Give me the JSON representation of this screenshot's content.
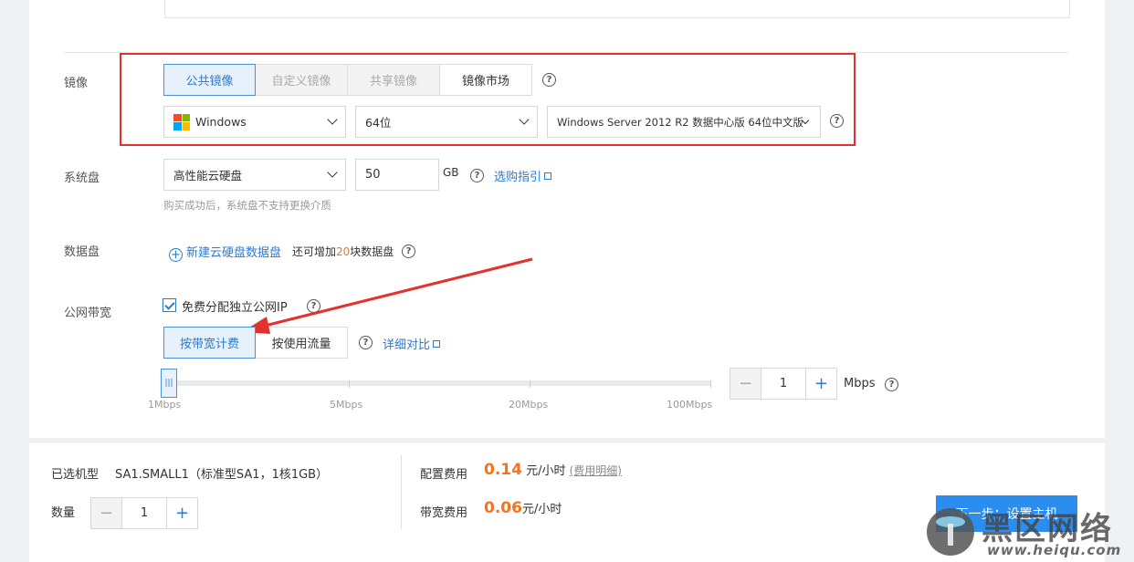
{
  "image_section": {
    "label": "镜像",
    "tabs": [
      {
        "label": "公共镜像",
        "state": "active"
      },
      {
        "label": "自定义镜像",
        "state": "disabled"
      },
      {
        "label": "共享镜像",
        "state": "disabled"
      },
      {
        "label": "镜像市场",
        "state": "normal"
      }
    ],
    "help": "?",
    "os_select": "Windows",
    "bits_select": "64位",
    "version_select": "Windows Server 2012 R2 数据中心版 64位中文版"
  },
  "system_disk": {
    "label": "系统盘",
    "type_select": "高性能云硬盘",
    "size_value": "50",
    "unit": "GB",
    "guide_link": "选购指引",
    "hint": "购买成功后，系统盘不支持更换介质"
  },
  "data_disk": {
    "label": "数据盘",
    "add_link": "新建云硬盘数据盘",
    "remaining_prefix": "还可增加",
    "remaining_count": "20",
    "remaining_suffix": "块数据盘"
  },
  "bandwidth": {
    "label": "公网带宽",
    "free_ip_checkbox": "免费分配独立公网IP",
    "free_ip_checked": true,
    "billing_tabs": [
      {
        "label": "按带宽计费",
        "state": "active"
      },
      {
        "label": "按使用流量",
        "state": "normal"
      }
    ],
    "compare_link": "详细对比",
    "slider_handle": "|||",
    "slider_ticks": [
      "1Mbps",
      "5Mbps",
      "20Mbps",
      "100Mbps"
    ],
    "value": "1",
    "unit": "Mbps"
  },
  "footer": {
    "model_label": "已选机型",
    "model_value": "SA1.SMALL1（标准型SA1，1核1GB）",
    "qty_label": "数量",
    "qty_value": "1",
    "config_fee_label": "配置费用",
    "config_fee_value": "0.14",
    "config_fee_unit": "元/小时",
    "fee_detail_link": "(费用明细)",
    "bw_fee_label": "带宽费用",
    "bw_fee_value": "0.06",
    "bw_fee_unit": "元/小时",
    "next_button": "下一步：设置主机"
  },
  "watermark": {
    "brand": "黑区网络",
    "url": "www.heiqu.com"
  },
  "colors": {
    "accent": "#2a7ad2",
    "active_tab_bg": "#e6f1fc",
    "price": "#f5731f",
    "annotation_red": "#e5312b",
    "next_button": "#2b8ded"
  }
}
